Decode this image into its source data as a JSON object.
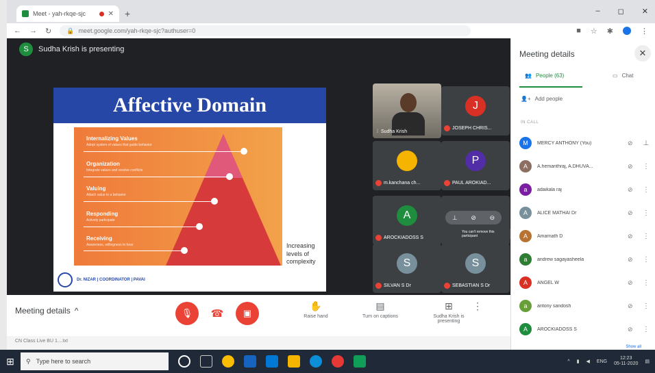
{
  "browser": {
    "tab_title": "Meet - yah-rkqe-sjc",
    "url": "meet.google.com/yah-rkqe-sjc?authuser=0",
    "account_initial": "M"
  },
  "presentation": {
    "presenter_initial": "S",
    "banner": "Sudha Krish is presenting",
    "slide_title": "Affective Domain",
    "levels": [
      {
        "name": "Internalizing Values",
        "sub": "Adopt system of values that guide behavior"
      },
      {
        "name": "Organization",
        "sub": "Integrate values and resolve conflicts"
      },
      {
        "name": "Valuing",
        "sub": "Attach value to a behavior"
      },
      {
        "name": "Responding",
        "sub": "Actively participate"
      },
      {
        "name": "Receiving",
        "sub": "Awareness, willingness to hear"
      }
    ],
    "side_note": "Increasing levels of complexity",
    "footer": "Dr. NIZAR | COORDINATOR | PAVAI"
  },
  "tiles": {
    "self": {
      "name": "Sudha Krish"
    },
    "joseph": {
      "initial": "J",
      "name": "JOSEPH CHRIS..."
    },
    "kanchana": {
      "name": "m.kanchana ch..."
    },
    "paul": {
      "initial": "P",
      "name": "PAUL AROKIAD..."
    },
    "arockiadoss": {
      "initial": "A",
      "name": "AROCKIADOSS S"
    },
    "silvan": {
      "initial": "S",
      "name": "SILVAN S Dr"
    },
    "sebastian": {
      "initial": "S",
      "name": "SEBASTIAN S Dr"
    },
    "tooltip": "You can't remove this participant"
  },
  "bottom_bar": {
    "meeting_details": "Meeting details",
    "raise_hand": "Raise hand",
    "captions": "Turn on captions",
    "presenting": "Sudha Krish is presenting"
  },
  "download_chip": "CN Class Live BU 1....txt",
  "panel": {
    "title": "Meeting details",
    "people_tab": "People (63)",
    "chat_tab": "Chat",
    "add_people": "Add people",
    "in_call": "IN CALL",
    "show_all": "Show all",
    "participants": [
      {
        "initial": "M",
        "name": "MERCY ANTHONY (You)",
        "color": "#1a73e8"
      },
      {
        "initial": "A",
        "name": "A.hemanthraj, A.DHUVA...",
        "color": "#8d6e63"
      },
      {
        "initial": "a",
        "name": "adaikala raj",
        "color": "#7b1fa2"
      },
      {
        "initial": "A",
        "name": "ALICE MATHAI Dr",
        "color": "#78909c"
      },
      {
        "initial": "A",
        "name": "Amarnath D",
        "color": "#b87333"
      },
      {
        "initial": "a",
        "name": "andrew sagayasheela",
        "color": "#2e7d32"
      },
      {
        "initial": "A",
        "name": "ANGEL W",
        "color": "#d93025"
      },
      {
        "initial": "a",
        "name": "antony sandosh",
        "color": "#689f38"
      },
      {
        "initial": "A",
        "name": "AROCKIADOSS S",
        "color": "#1e8e3e"
      }
    ]
  },
  "taskbar": {
    "search_placeholder": "Type here to search",
    "lang": "ENG",
    "time": "12:23",
    "date": "05-11-2020"
  },
  "colors": {
    "slide_header": "#2747a6",
    "meet_green": "#1e8e3e",
    "danger_red": "#ea4335"
  }
}
